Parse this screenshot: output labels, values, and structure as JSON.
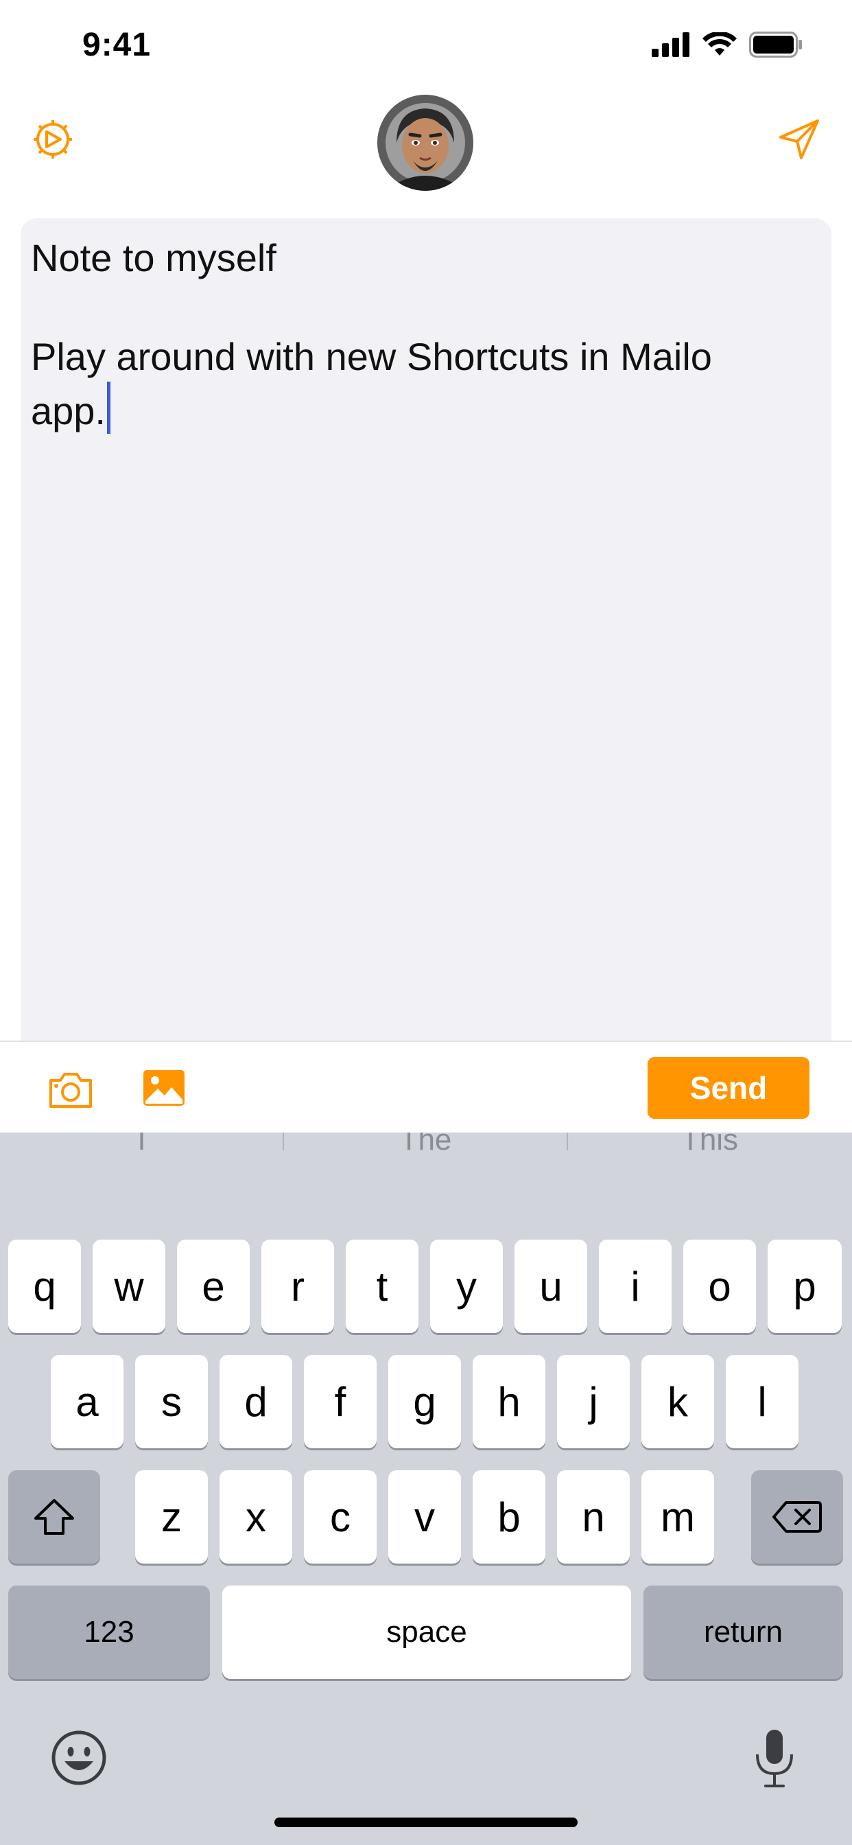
{
  "status_bar": {
    "time": "9:41"
  },
  "nav": {
    "settings_icon": "settings-gear-icon",
    "avatar_icon": "user-avatar",
    "send_icon": "paper-plane-icon",
    "accent_color": "#ff9500"
  },
  "editor": {
    "text": "Note to myself\n\nPlay around with new Shortcuts in Mailo\napp."
  },
  "toolbar": {
    "camera_icon": "camera-icon",
    "photo_icon": "photo-library-icon",
    "send_label": "Send"
  },
  "keyboard": {
    "suggestions": [
      "I",
      "The",
      "This"
    ],
    "row1": [
      "q",
      "w",
      "e",
      "r",
      "t",
      "y",
      "u",
      "i",
      "o",
      "p"
    ],
    "row2": [
      "a",
      "s",
      "d",
      "f",
      "g",
      "h",
      "j",
      "k",
      "l"
    ],
    "row3": [
      "z",
      "x",
      "c",
      "v",
      "b",
      "n",
      "m"
    ],
    "numbers_label": "123",
    "space_label": "space",
    "return_label": "return",
    "shift_icon": "shift-icon",
    "delete_icon": "delete-icon",
    "emoji_icon": "emoji-icon",
    "mic_icon": "microphone-icon"
  }
}
